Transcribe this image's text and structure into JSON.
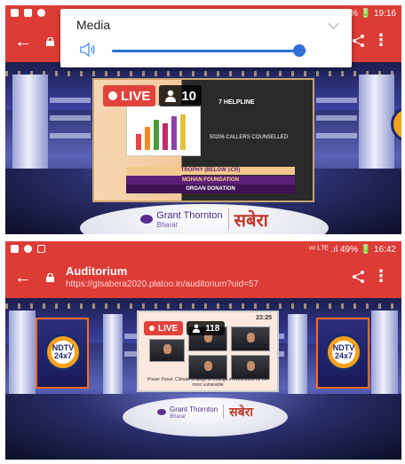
{
  "screenshot_top": {
    "status": {
      "right_text": "0% 🔋 19:16"
    },
    "appbar": {
      "back_glyph": "←",
      "more_glyph": "⋮"
    },
    "media_popup": {
      "label": "Media",
      "volume_fraction": 0.96
    },
    "live": {
      "label": "LIVE",
      "viewer_count": "10"
    },
    "slide": {
      "helpline": "7 HELPLINE",
      "counsellors": "50206 CALLERS COUNSELLED",
      "trophy": "TROPHY (BELOW 1CR)",
      "org": "MOHAN FOUNDATION",
      "cause": "ORGAN DONATION"
    },
    "podium": {
      "brand": "Grant Thornton",
      "brand_sub": "Bharat",
      "savera": "सबेरा"
    }
  },
  "screenshot_bottom": {
    "status": {
      "right_text": "ᵛᵒ ᴸᵀᴱ .ıl 49% 🔋 16:42"
    },
    "appbar": {
      "back_glyph": "←",
      "title": "Auditorium",
      "url": "https://gtsabera2020.platoo.in/auditorium?uid=57",
      "more_glyph": "⋮"
    },
    "live": {
      "label": "LIVE",
      "viewer_count": "118"
    },
    "slide": {
      "time": "23:25",
      "caption": "Power Panel: Climate Change & Change in livelihoods for the most vulnerable"
    },
    "ndtv": {
      "line1": "NDTV",
      "line2": "24x7"
    },
    "podium": {
      "brand": "Grant Thornton",
      "brand_sub": "Bharat",
      "savera": "सबेरा"
    }
  },
  "colors": {
    "appbar": "#dd3b36",
    "live": "#e0433c",
    "slider": "#2f6fd6"
  }
}
